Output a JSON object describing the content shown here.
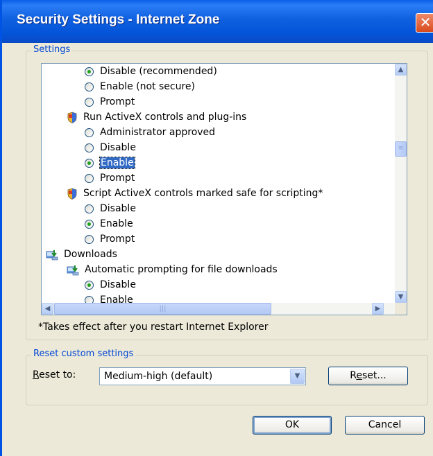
{
  "window": {
    "title": "Security Settings - Internet Zone",
    "close_glyph": "✕"
  },
  "settings_group": {
    "label": "Settings"
  },
  "tree": {
    "rows": [
      {
        "kind": "radio",
        "label": "Disable (recommended)",
        "checked": true
      },
      {
        "kind": "radio",
        "label": "Enable (not secure)",
        "checked": false
      },
      {
        "kind": "radio",
        "label": "Prompt",
        "checked": false
      },
      {
        "kind": "shield",
        "label": "Run ActiveX controls and plug-ins",
        "icon": "shield-icon"
      },
      {
        "kind": "radio",
        "label": "Administrator approved",
        "checked": false
      },
      {
        "kind": "radio",
        "label": "Disable",
        "checked": false
      },
      {
        "kind": "radio",
        "label": "Enable",
        "checked": true,
        "selected": true
      },
      {
        "kind": "radio",
        "label": "Prompt",
        "checked": false
      },
      {
        "kind": "shield",
        "label": "Script ActiveX controls marked safe for scripting*",
        "icon": "shield-icon"
      },
      {
        "kind": "radio",
        "label": "Disable",
        "checked": false
      },
      {
        "kind": "radio",
        "label": "Enable",
        "checked": true
      },
      {
        "kind": "radio",
        "label": "Prompt",
        "checked": false
      },
      {
        "kind": "category",
        "label": "Downloads",
        "icon": "downloads-icon"
      },
      {
        "kind": "download",
        "label": "Automatic prompting for file downloads",
        "icon": "download-setting-icon"
      },
      {
        "kind": "radio",
        "label": "Disable",
        "checked": true
      },
      {
        "kind": "radio",
        "label": "Enable",
        "checked": false
      }
    ]
  },
  "note": "*Takes effect after you restart Internet Explorer",
  "reset_group": {
    "label": "Reset custom settings",
    "reset_to_prefix": "R",
    "reset_to_rest": "eset to:",
    "combo_value": "Medium-high (default)",
    "reset_button_prefix": "R",
    "reset_button_u": "e",
    "reset_button_rest": "set..."
  },
  "buttons": {
    "ok": "OK",
    "cancel": "Cancel"
  },
  "colors": {
    "titlebar": "#0453d8",
    "group_label": "#0046d5",
    "selection": "#316ac5",
    "dialog_bg": "#ece9d8"
  }
}
